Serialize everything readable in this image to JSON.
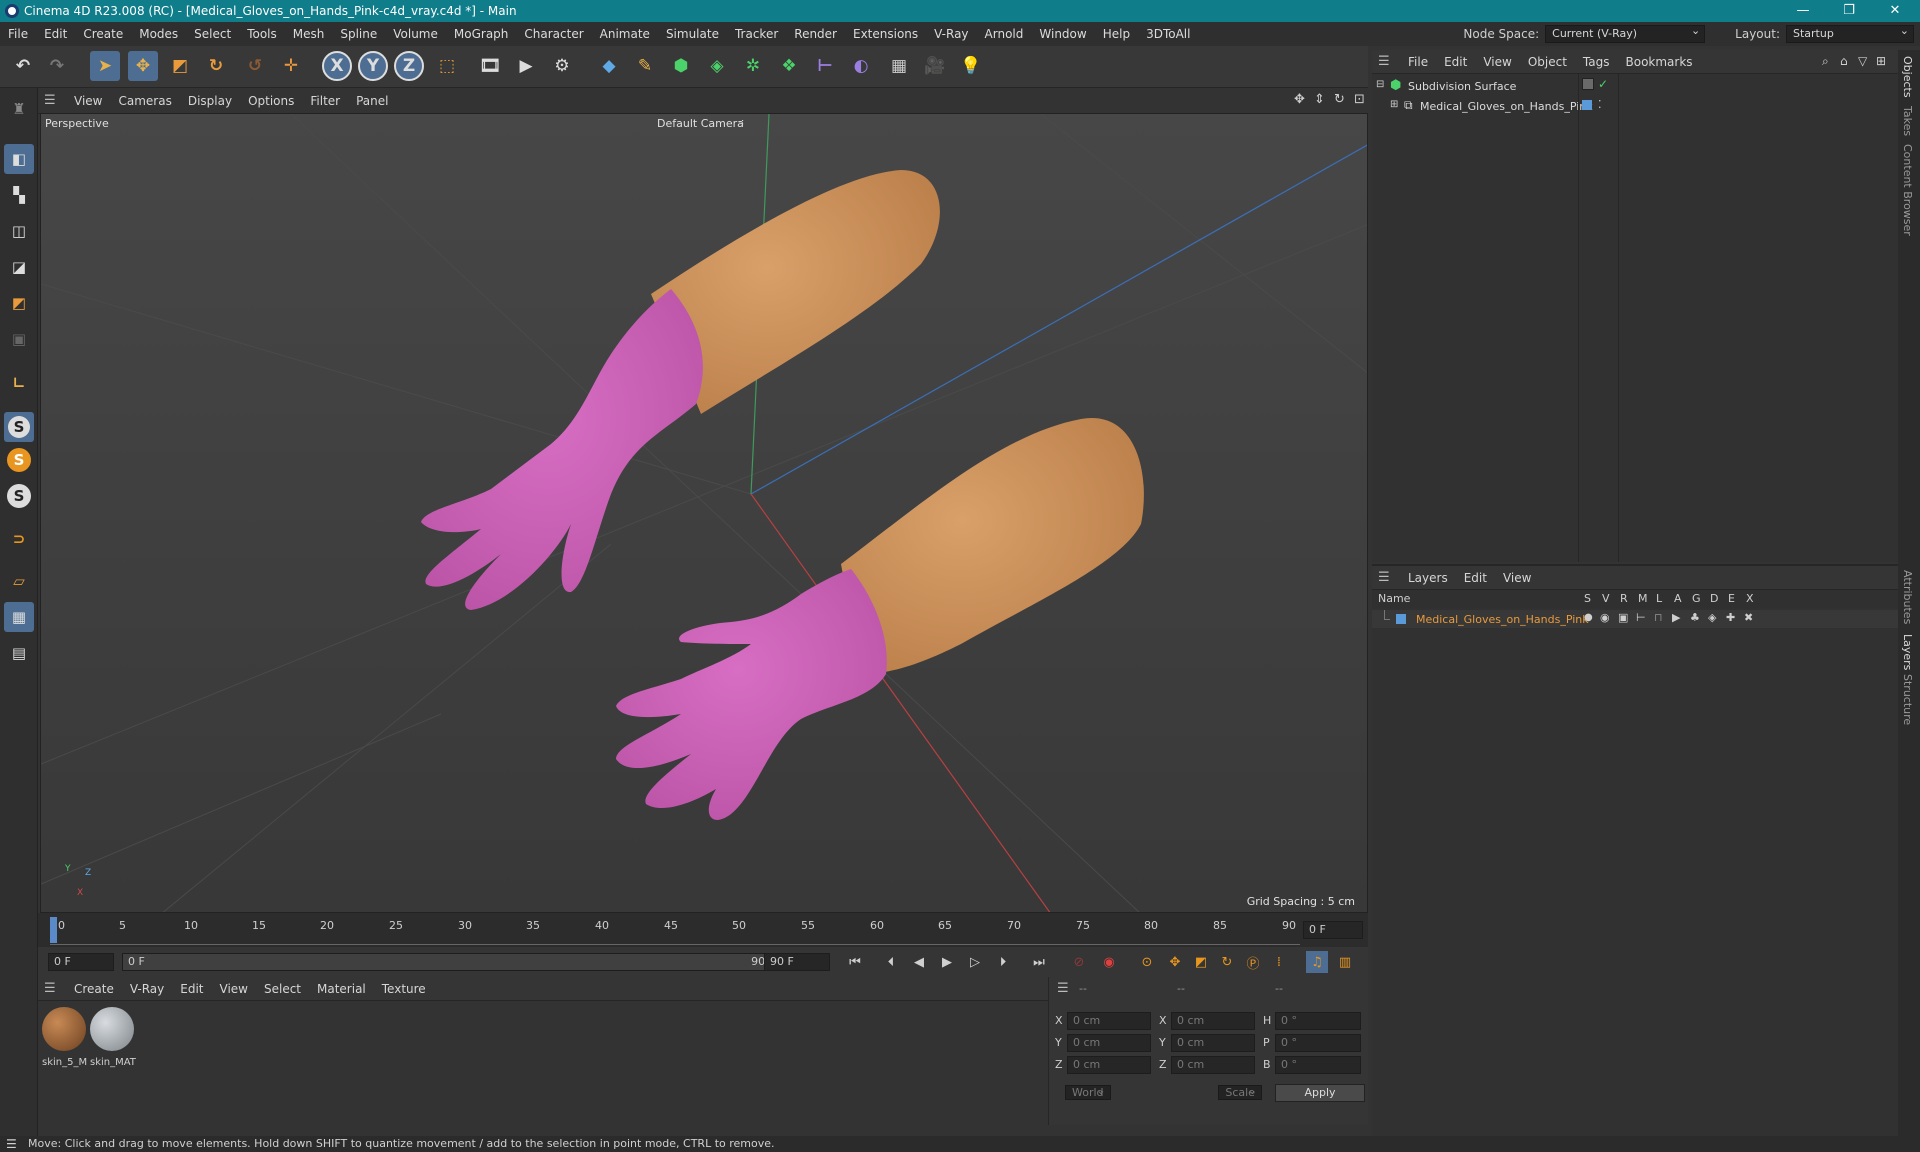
{
  "window": {
    "title": "Cinema 4D R23.008 (RC) - [Medical_Gloves_on_Hands_Pink-c4d_vray.c4d *] - Main",
    "minimize": "—",
    "restore": "❐",
    "close": "✕"
  },
  "menubar": {
    "items": [
      "File",
      "Edit",
      "Create",
      "Modes",
      "Select",
      "Tools",
      "Mesh",
      "Spline",
      "Volume",
      "MoGraph",
      "Character",
      "Animate",
      "Simulate",
      "Tracker",
      "Render",
      "Extensions",
      "V-Ray",
      "Arnold",
      "Window",
      "Help",
      "3DToAll"
    ],
    "node_space_label": "Node Space:",
    "node_space_value": "Current (V-Ray)",
    "layout_label": "Layout:",
    "layout_value": "Startup"
  },
  "toolbar": {
    "x_label": "X",
    "y_label": "Y",
    "z_label": "Z"
  },
  "left_tools": {
    "s1": "S",
    "s2": "S",
    "s3": "S"
  },
  "viewport": {
    "menu": [
      "View",
      "Cameras",
      "Display",
      "Options",
      "Filter",
      "Panel"
    ],
    "view_name": "Perspective",
    "camera": "Default Camera",
    "grid_spacing": "Grid Spacing : 5 cm",
    "axis_y": "Y",
    "axis_z": "Z",
    "axis_x": "X"
  },
  "timeline": {
    "ticks": [
      "0",
      "5",
      "10",
      "15",
      "20",
      "25",
      "30",
      "35",
      "40",
      "45",
      "50",
      "55",
      "60",
      "65",
      "70",
      "75",
      "80",
      "85",
      "90"
    ],
    "current_frame": "0 F",
    "start_field": "0 F",
    "range_start": "0 F",
    "range_end": "90 F",
    "end_field": "90 F"
  },
  "materials": {
    "menu": [
      "Create",
      "V-Ray",
      "Edit",
      "View",
      "Select",
      "Material",
      "Texture"
    ],
    "items": [
      {
        "name": "skin_5_M",
        "color": "#8a5a34"
      },
      {
        "name": "skin_MAT",
        "color": "#9aa0a6"
      }
    ]
  },
  "coords": {
    "col_headers": [
      "--",
      "--",
      "--"
    ],
    "rows": [
      {
        "a": "X",
        "av": "0 cm",
        "b": "X",
        "bv": "0 cm",
        "c": "H",
        "cv": "0 °"
      },
      {
        "a": "Y",
        "av": "0 cm",
        "b": "Y",
        "bv": "0 cm",
        "c": "P",
        "cv": "0 °"
      },
      {
        "a": "Z",
        "av": "0 cm",
        "b": "Z",
        "bv": "0 cm",
        "c": "B",
        "cv": "0 °"
      }
    ],
    "mode": "World",
    "scale": "Scale",
    "apply": "Apply"
  },
  "objects": {
    "menu": [
      "File",
      "Edit",
      "View",
      "Object",
      "Tags",
      "Bookmarks"
    ],
    "tree": [
      {
        "name": "Subdivision Surface"
      },
      {
        "name": "Medical_Gloves_on_Hands_Pink"
      }
    ]
  },
  "layers": {
    "menu": [
      "Layers",
      "Edit",
      "View"
    ],
    "col_name": "Name",
    "flags": [
      "S",
      "V",
      "R",
      "M",
      "L",
      "A",
      "G",
      "D",
      "E",
      "X"
    ],
    "rows": [
      {
        "name": "Medical_Gloves_on_Hands_Pink",
        "color": "#5a9ad8"
      }
    ]
  },
  "side_tabs": {
    "objects": "Objects",
    "takes": "Takes",
    "content_browser": "Content Browser",
    "attributes": "Attributes",
    "layers": "Layers",
    "structure": "Structure"
  },
  "status": {
    "text": "Move: Click and drag to move elements. Hold down SHIFT to quantize movement / add to the selection in point mode, CTRL to remove."
  },
  "colors": {
    "titlebar": "#0f7d8a",
    "glove": "#c85cb4",
    "skin": "#c9905b",
    "selection": "#4d6d92",
    "layer_text": "#e89a3c"
  }
}
